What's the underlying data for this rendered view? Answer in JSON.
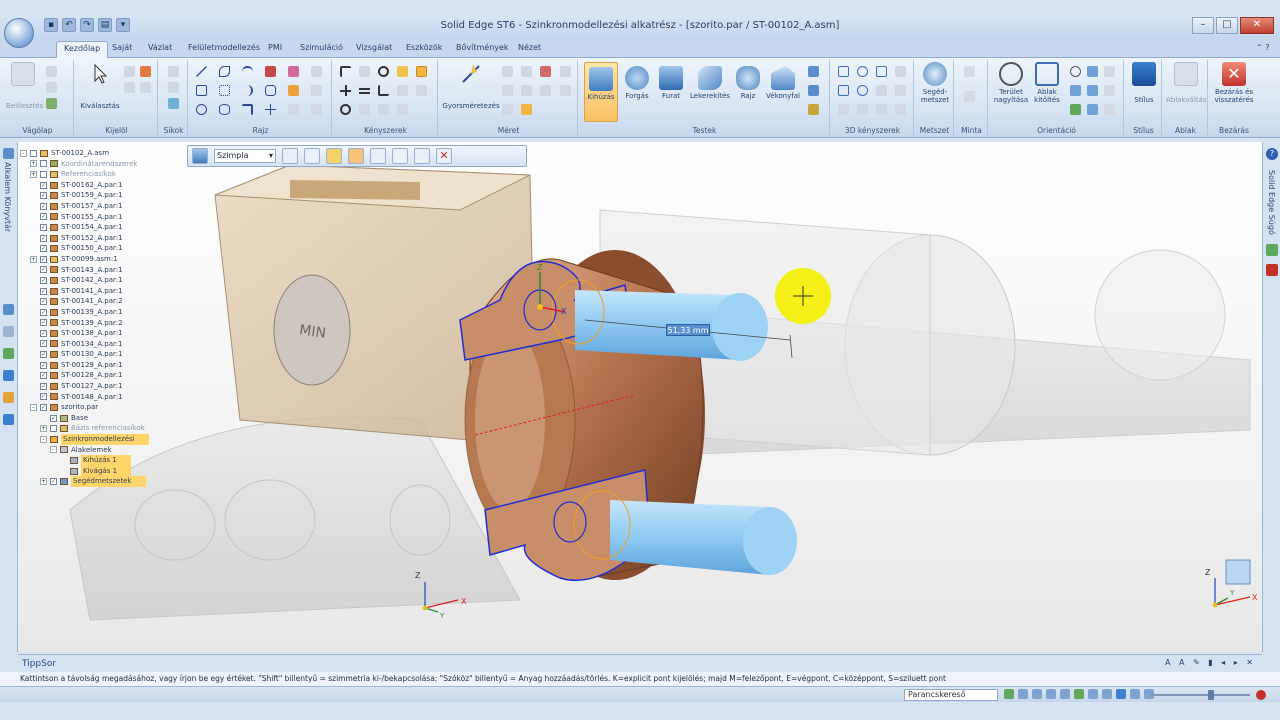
{
  "window": {
    "title": "Solid Edge ST6 - Szinkronmodellezési alkatrész - [szorito.par / ST-00102_A.asm]",
    "min": "–",
    "max": "□",
    "close": "✕"
  },
  "ribbon": {
    "tabs": [
      "Kezdőlap",
      "Saját",
      "Vázlat",
      "Felületmodellezés",
      "PMI",
      "Szimuláció",
      "Vizsgálat",
      "Eszközök",
      "Bővítmények",
      "Nézet"
    ],
    "active_tab": "Kezdőlap",
    "groups": {
      "clipboard": {
        "label": "Vágólap",
        "paste": "Beillesztés"
      },
      "select": {
        "label": "Kijelöl",
        "select": "Kiválasztás"
      },
      "planes": {
        "label": "Síkok"
      },
      "draw": {
        "label": "Rajz"
      },
      "relate": {
        "label": "Kényszerek"
      },
      "dimension": {
        "label": "Méret",
        "smart": "Gyorsméretezés"
      },
      "solids": {
        "label": "Testek",
        "extrude": "Kihúzás",
        "revolve": "Forgás",
        "hole": "Furat",
        "round": "Lekerekítés",
        "draft": "Rajz",
        "thin": "Vékonyfal"
      },
      "relate3d": {
        "label": "3D kényszerek"
      },
      "section": {
        "label": "Metszet",
        "btn": "Segéd-metszet"
      },
      "pattern": {
        "label": "Minta"
      },
      "orient": {
        "label": "Orientáció",
        "zoom_area": "Terület nagyítása",
        "fit": "Ablak kitöltés"
      },
      "style": {
        "label": "Stílus",
        "btn": "Stílus"
      },
      "window": {
        "label": "Ablak",
        "btn": "Ablakváltás"
      },
      "close": {
        "label": "Bezárás",
        "btn": "Bezárás és visszatérés"
      }
    }
  },
  "left_panel_tab": "Alkalem Könyvtár",
  "right_panel_tab": "Solid Edge Súgó",
  "command_bar": {
    "select_value": "Szimpla"
  },
  "tree": [
    {
      "label": "ST-00102_A.asm",
      "level": 0,
      "icon": "assembly",
      "checked": false,
      "expand": "-"
    },
    {
      "label": "Koordinátarendszerek",
      "level": 1,
      "icon": "csys",
      "checked": false,
      "expand": "+"
    },
    {
      "label": "Referenciasíkok",
      "level": 1,
      "icon": "planes",
      "checked": false,
      "expand": "+"
    },
    {
      "label": "ST-00162_A.par:1",
      "level": 1,
      "icon": "part",
      "checked": true
    },
    {
      "label": "ST-00159_A.par:1",
      "level": 1,
      "icon": "part",
      "checked": true
    },
    {
      "label": "ST-00157_A.par:1",
      "level": 1,
      "icon": "part",
      "checked": true
    },
    {
      "label": "ST-00155_A.par:1",
      "level": 1,
      "icon": "part",
      "checked": true
    },
    {
      "label": "ST-00154_A.par:1",
      "level": 1,
      "icon": "part",
      "checked": true
    },
    {
      "label": "ST-00152_A.par:1",
      "level": 1,
      "icon": "part",
      "checked": true
    },
    {
      "label": "ST-00150_A.par:1",
      "level": 1,
      "icon": "part",
      "checked": true
    },
    {
      "label": "ST-00099.asm:1",
      "level": 1,
      "icon": "assembly",
      "checked": true,
      "expand": "+"
    },
    {
      "label": "ST-00143_A.par:1",
      "level": 1,
      "icon": "part",
      "checked": true
    },
    {
      "label": "ST-00142_A.par:1",
      "level": 1,
      "icon": "part",
      "checked": true
    },
    {
      "label": "ST-00141_A.par:1",
      "level": 1,
      "icon": "part",
      "checked": true
    },
    {
      "label": "ST-00141_A.par:2",
      "level": 1,
      "icon": "part",
      "checked": true
    },
    {
      "label": "ST-00139_A.par:1",
      "level": 1,
      "icon": "part",
      "checked": true
    },
    {
      "label": "ST-00139_A.par:2",
      "level": 1,
      "icon": "part",
      "checked": true
    },
    {
      "label": "ST-00138_A.par:1",
      "level": 1,
      "icon": "part",
      "checked": true
    },
    {
      "label": "ST-00134_A.par:1",
      "level": 1,
      "icon": "part",
      "checked": true
    },
    {
      "label": "ST-00130_A.par:1",
      "level": 1,
      "icon": "part",
      "checked": true
    },
    {
      "label": "ST-00129_A.par:1",
      "level": 1,
      "icon": "part",
      "checked": true
    },
    {
      "label": "ST-00128_A.par:1",
      "level": 1,
      "icon": "part",
      "checked": true
    },
    {
      "label": "ST-00127_A.par:1",
      "level": 1,
      "icon": "part",
      "checked": true
    },
    {
      "label": "ST-00148_A.par:1",
      "level": 1,
      "icon": "part",
      "checked": true
    },
    {
      "label": "szorito.par",
      "level": 1,
      "icon": "part",
      "checked": true,
      "expand": "-"
    },
    {
      "label": "Base",
      "level": 2,
      "icon": "body",
      "checked": true
    },
    {
      "label": "Bázis referenciasíkok",
      "level": 2,
      "icon": "planes",
      "checked": false,
      "expand": "+"
    },
    {
      "label": "Szinkronmodellezési",
      "level": 2,
      "icon": "sync",
      "checked": null,
      "expand": "-",
      "highlight": true
    },
    {
      "label": "Alakelemek",
      "level": 3,
      "icon": "features",
      "checked": null,
      "expand": "-"
    },
    {
      "label": "Kihúzás 1",
      "level": 4,
      "icon": "feature",
      "checked": null,
      "highlight": true
    },
    {
      "label": "Kivágás 1",
      "level": 4,
      "icon": "feature",
      "checked": null,
      "highlight": true
    },
    {
      "label": "Segédmetszetek",
      "level": 2,
      "icon": "section",
      "checked": true,
      "expand": "+",
      "highlight": true
    }
  ],
  "dimension_value": "51,33 mm",
  "axes": {
    "z": "Z",
    "x": "X",
    "y": "Y"
  },
  "tipp": {
    "title": "TippSor",
    "text": "Kattintson a távolság megadásához, vagy írjon be egy értéket.  \"Shift\" billentyű = szimmetria ki-/bekapcsolása; \"Szóköz\" billentyű = Anyag hozzáadás/törlés.  K=explicit pont kijelölés; majd M=felezőpont, E=végpont, C=középpont, S=sziluett pont"
  },
  "status": {
    "command_finder": "Parancskereső"
  },
  "colors": {
    "accent": "#f8c163",
    "part_copper": "#b8744f",
    "cyl_blue": "#8ec9f2",
    "highlight_edge": "#1f2fd6",
    "sketch_orange": "#f0a020"
  }
}
